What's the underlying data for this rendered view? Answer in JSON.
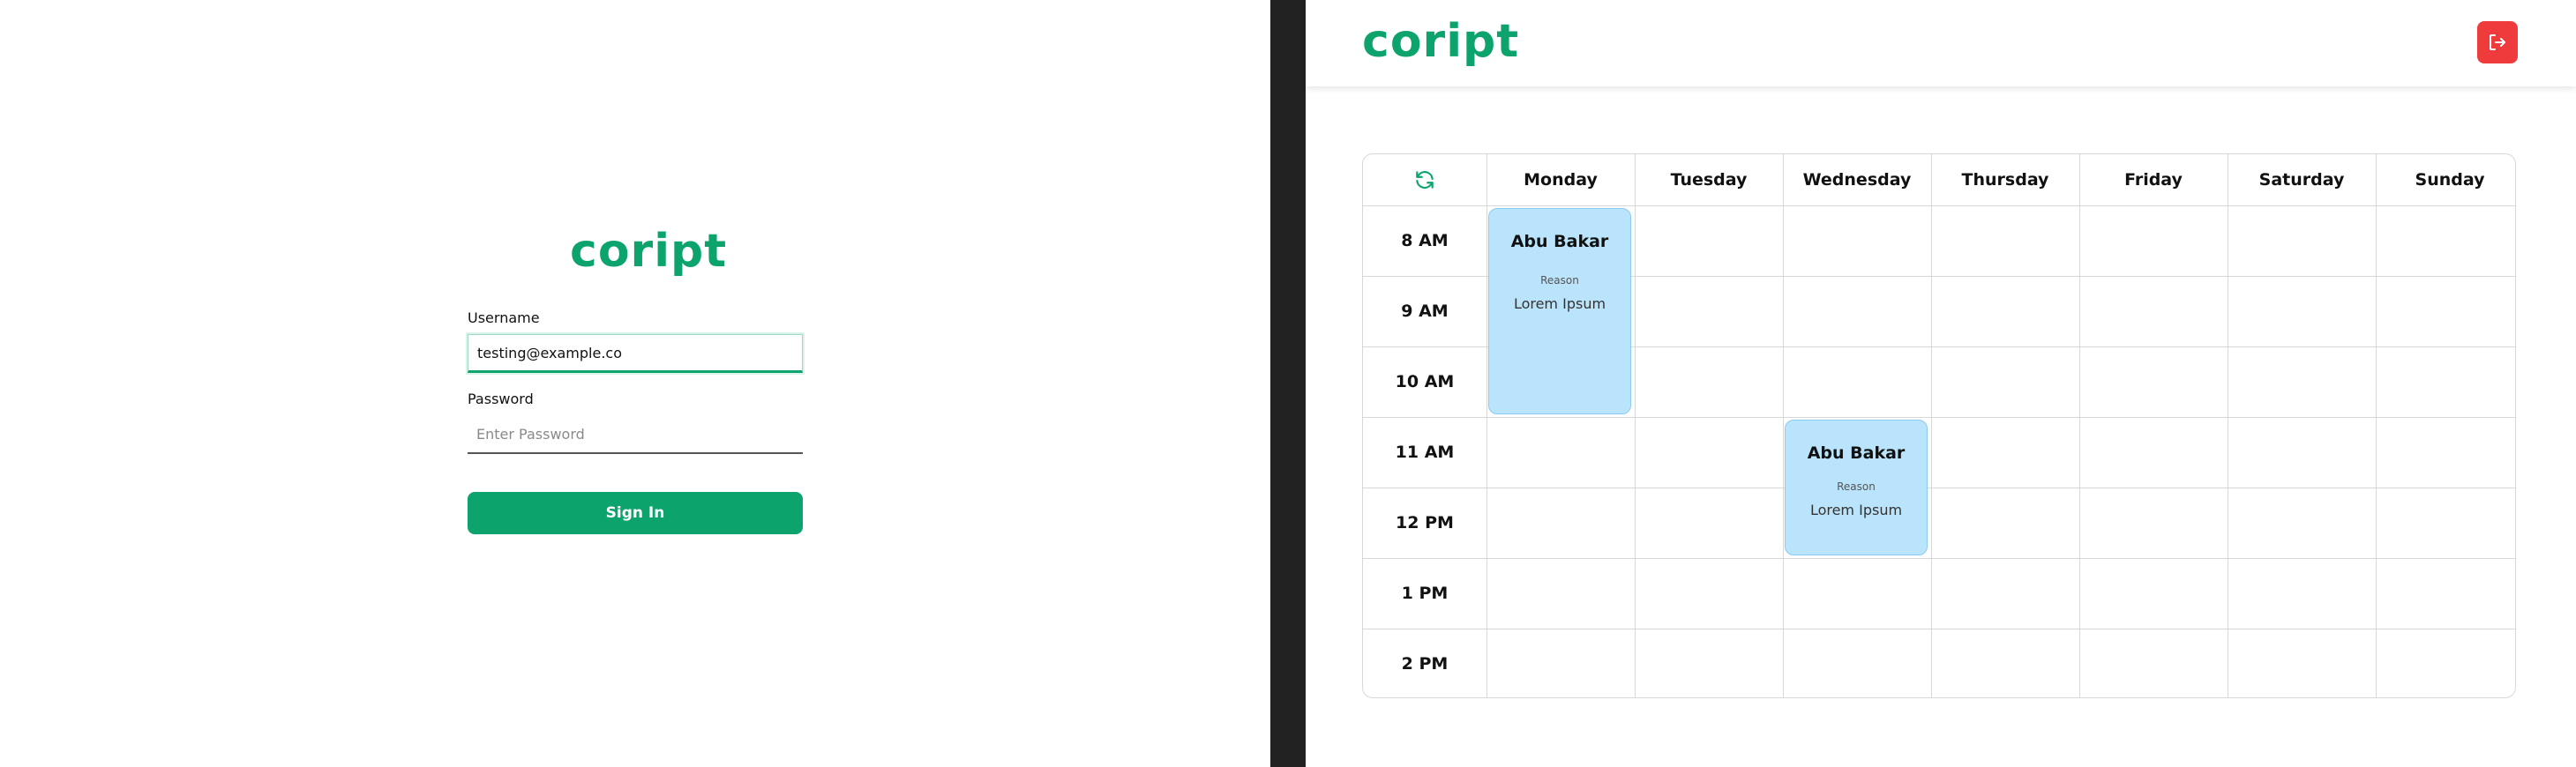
{
  "brand": {
    "logo_text": "coript",
    "accent_color": "#0da36d"
  },
  "login": {
    "username_label": "Username",
    "username_value": "testing@example.co",
    "password_label": "Password",
    "password_placeholder": "Enter Password",
    "sign_in_label": "Sign In"
  },
  "header": {
    "logout_icon": "logout-icon",
    "logout_color": "#ef3b3b"
  },
  "calendar": {
    "refresh_icon": "refresh-icon",
    "days": [
      "Monday",
      "Tuesday",
      "Wednesday",
      "Thursday",
      "Friday",
      "Saturday",
      "Sunday"
    ],
    "times": [
      "8 AM",
      "9 AM",
      "10 AM",
      "11 AM",
      "12 PM",
      "1 PM",
      "2 PM"
    ],
    "events": [
      {
        "day": "Monday",
        "start": "8 AM",
        "end": "10 AM",
        "name": "Abu Bakar",
        "reason_label": "Reason",
        "reason": "Lorem Ipsum"
      },
      {
        "day": "Wednesday",
        "start": "11 AM",
        "end": "12 PM",
        "name": "Abu Bakar",
        "reason_label": "Reason",
        "reason": "Lorem Ipsum"
      }
    ],
    "event_color": "#bae4fb"
  }
}
